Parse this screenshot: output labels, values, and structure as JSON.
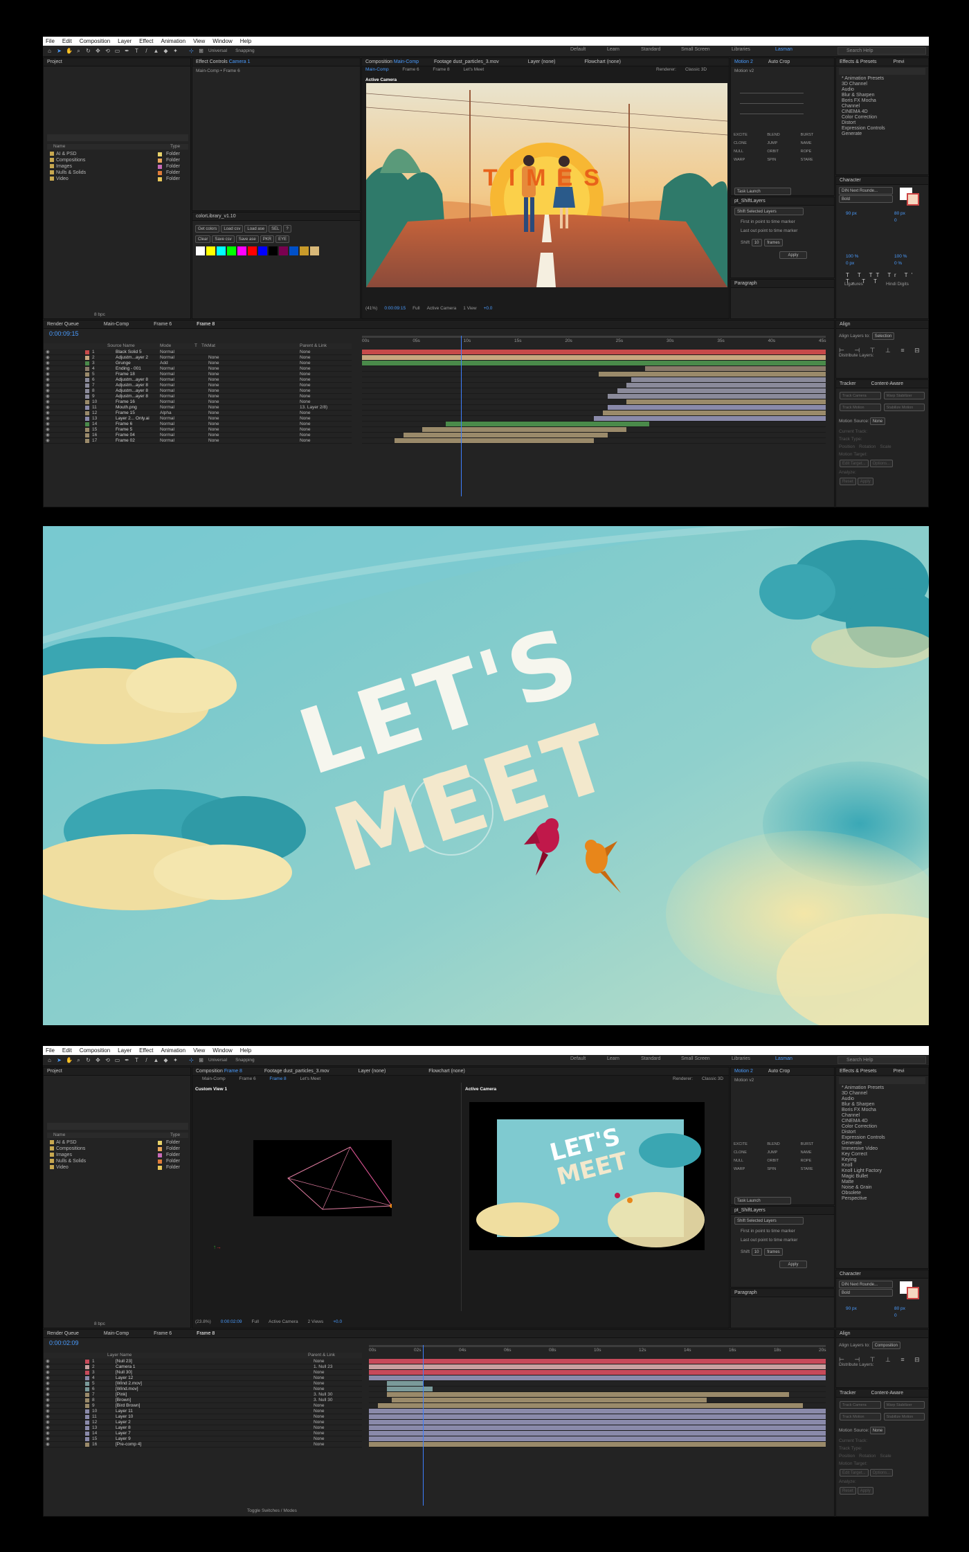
{
  "menu": [
    "File",
    "Edit",
    "Composition",
    "Layer",
    "Effect",
    "Animation",
    "View",
    "Window",
    "Help"
  ],
  "toolbar": {
    "universal": "Universal",
    "snapping": "Snapping"
  },
  "workspaces": [
    "Default",
    "Learn",
    "Standard",
    "Small Screen",
    "Libraries",
    "Lasman"
  ],
  "search_placeholder": "Search Help",
  "project": {
    "title": "Project",
    "col_name": "Name",
    "col_type": "Type",
    "folders": [
      {
        "name": "AI & PSD",
        "type": "Folder",
        "color": "#e8d36a"
      },
      {
        "name": "Compositions",
        "type": "Folder",
        "color": "#e8a55a"
      },
      {
        "name": "Images",
        "type": "Folder",
        "color": "#c86ab8"
      },
      {
        "name": "Nulls & Solids",
        "type": "Folder",
        "color": "#e07c3a"
      },
      {
        "name": "Video",
        "type": "Folder",
        "color": "#e8c75a"
      }
    ],
    "bpc": "8 bpc"
  },
  "effect_controls": {
    "title": "Effect Controls",
    "target": "Camera 1",
    "subtitle": "Main-Comp • Frame 6"
  },
  "colorlib": {
    "title": "colorLibrary_v1.10",
    "buttons1": [
      "Get colors",
      "Load csv",
      "Load ase",
      "SEL",
      "?"
    ],
    "buttons2": [
      "Clear",
      "Save csv",
      "Save ase",
      "PKR",
      "EYE"
    ],
    "swatches": [
      "#ffffff",
      "#ffff00",
      "#00ffff",
      "#00ff00",
      "#ff00ff",
      "#ff0000",
      "#0000ff",
      "#000000",
      "#7a0050",
      "#0050c8",
      "#c89a2a",
      "#d8b878"
    ]
  },
  "comp1": {
    "title": "Composition",
    "name": "Main-Comp",
    "footage": "Footage dust_particles_3.mov",
    "layer": "Layer (none)",
    "flowchart": "Flowchart (none)",
    "tabs": [
      "Main-Comp",
      "Frame 6",
      "Frame 8",
      "Let's Meet"
    ],
    "renderer": "Renderer:",
    "renderer_val": "Classic 3D",
    "view_label": "Active Camera",
    "zoom": "(41%)",
    "time": "0:00:09:15",
    "res": "Full",
    "camera": "Active Camera",
    "views": "1 View",
    "exposure": "+0.0"
  },
  "scene_text": "TIMES",
  "motion": {
    "title": "Motion 2",
    "autocrop": "Auto Crop",
    "preset": "Motion v2",
    "task": "Task Launch",
    "buttons": [
      "EXCITE",
      "BLEND",
      "BURST",
      "CLONE",
      "JUMP",
      "NAME",
      "NULL",
      "ORBIT",
      "ROPE",
      "WARP",
      "SPIN",
      "STARE"
    ]
  },
  "shift": {
    "title": "pt_ShiftLayers",
    "mode": "Shift Selected Layers",
    "opt1": "First in point to time marker",
    "opt2": "Last out point to time marker",
    "shift": "Shift",
    "amount": "10",
    "unit": "frames",
    "apply": "Apply"
  },
  "paragraph": {
    "title": "Paragraph"
  },
  "fxpresets": {
    "title": "Effects & Presets",
    "tab2": "Previ",
    "items": [
      "* Animation Presets",
      "3D Channel",
      "Audio",
      "Blur & Sharpen",
      "Boris FX Mocha",
      "Channel",
      "CINEMA 4D",
      "Color Correction",
      "Distort",
      "Expression Controls",
      "Generate"
    ]
  },
  "fxpresets2": [
    "* Animation Presets",
    "3D Channel",
    "Audio",
    "Blur & Sharpen",
    "Boris FX Mocha",
    "Channel",
    "CINEMA 4D",
    "Color Correction",
    "Distort",
    "Expression Controls",
    "Generate",
    "Immersive Video",
    "Key Correct",
    "Keying",
    "Knoll",
    "Knoll Light Factory",
    "Magic Bullet",
    "Matte",
    "Noise & Grain",
    "Obsolete",
    "Perspective"
  ],
  "character": {
    "title": "Character",
    "font": "DIN Next Rounde...",
    "style": "Bold",
    "size": "90 px",
    "lead": "80 px",
    "tracking": "0",
    "kern": "0",
    "scale_v": "100 %",
    "scale_h": "100 %",
    "baseline": "0 px",
    "tsume": "0 %",
    "ligatures": "Ligatures",
    "hindi": "Hindi Digits"
  },
  "align": {
    "title": "Align",
    "label": "Align Layers to:",
    "val": "Selection",
    "val2": "Composition",
    "distribute": "Distribute Layers:"
  },
  "tracker": {
    "title": "Tracker",
    "tab2": "Content-Aware",
    "motion_source": "Motion Source:",
    "none": "None",
    "current": "Current Track:",
    "track_type": "Track Type:",
    "stabilize": "Stabilize",
    "position": "Position",
    "rotation": "Rotation",
    "scale": "Scale",
    "motion_target": "Motion Target:",
    "edit_target": "Edit Target...",
    "options": "Options...",
    "analyze": "Analyze:",
    "reset": "Reset",
    "apply": "Apply",
    "track_camera": "Track Camera",
    "warp": "Warp Stabilizer",
    "track_motion": "Track Motion",
    "stabilize_motion": "Stabilize Motion"
  },
  "timeline1": {
    "tabs": [
      "Render Queue",
      "Main-Comp",
      "Frame 6",
      "Frame 8"
    ],
    "time": "0:00:09:15",
    "cols": {
      "source": "Source Name",
      "mode": "Mode",
      "t": "T",
      "trkmat": "TrkMat",
      "parent": "Parent & Link"
    },
    "ticks": [
      "00s",
      "05s",
      "10s",
      "15s",
      "20s",
      "25s",
      "30s",
      "35s",
      "40s",
      "45s"
    ],
    "layers": [
      {
        "n": "1",
        "name": "Black Solid 5",
        "mode": "Normal",
        "trk": "",
        "par": "None",
        "color": "#c74a4a"
      },
      {
        "n": "2",
        "name": "Adjustm...ayer 2",
        "mode": "Normal",
        "trk": "None",
        "par": "None",
        "color": "#c8a880"
      },
      {
        "n": "3",
        "name": "Grunge",
        "mode": "Add",
        "trk": "None",
        "par": "None",
        "color": "#4a8a4a"
      },
      {
        "n": "4",
        "name": "Ending - 001",
        "mode": "Normal",
        "trk": "None",
        "par": "None",
        "color": "#8a7a6a"
      },
      {
        "n": "5",
        "name": "Frame 18",
        "mode": "Normal",
        "trk": "None",
        "par": "None",
        "color": "#9a8a6a"
      },
      {
        "n": "6",
        "name": "Adjustm...ayer 8",
        "mode": "Normal",
        "trk": "None",
        "par": "None",
        "color": "#8a8a9a"
      },
      {
        "n": "7",
        "name": "Adjustm...ayer 8",
        "mode": "Normal",
        "trk": "None",
        "par": "None",
        "color": "#8a8a9a"
      },
      {
        "n": "8",
        "name": "Adjustm...ayer 8",
        "mode": "Normal",
        "trk": "None",
        "par": "None",
        "color": "#8a8a9a"
      },
      {
        "n": "9",
        "name": "Adjustm...ayer 8",
        "mode": "Normal",
        "trk": "None",
        "par": "None",
        "color": "#8a8a9a"
      },
      {
        "n": "10",
        "name": "Frame 16",
        "mode": "Normal",
        "trk": "None",
        "par": "None",
        "color": "#9a8a6a"
      },
      {
        "n": "11",
        "name": "Mouth.png",
        "mode": "Normal",
        "trk": "None",
        "par": "13. Layer 2/8)",
        "color": "#8a8aaa"
      },
      {
        "n": "12",
        "name": "Frame 15",
        "mode": "Alpha",
        "trk": "None",
        "par": "None",
        "color": "#9a8a6a"
      },
      {
        "n": "13",
        "name": "Layer 2... Only.ai",
        "mode": "Normal",
        "trk": "None",
        "par": "None",
        "color": "#8a8aaa"
      },
      {
        "n": "14",
        "name": "Frame 6",
        "mode": "Normal",
        "trk": "None",
        "par": "None",
        "color": "#4a8a4a"
      },
      {
        "n": "15",
        "name": "Frame 5",
        "mode": "Normal",
        "trk": "None",
        "par": "None",
        "color": "#9a8a6a"
      },
      {
        "n": "16",
        "name": "Frame 04",
        "mode": "Normal",
        "trk": "None",
        "par": "None",
        "color": "#9a8a6a"
      },
      {
        "n": "17",
        "name": "Frame 02",
        "mode": "Normal",
        "trk": "None",
        "par": "None",
        "color": "#9a8a6a"
      }
    ]
  },
  "art_title": {
    "line1": "LET'S",
    "line2": "MEET"
  },
  "comp2": {
    "title": "Composition",
    "name": "Frame 8",
    "footage": "Footage dust_particles_3.mov",
    "layer": "Layer (none)",
    "flowchart": "Flowchart (none)",
    "tabs": [
      "Main-Comp",
      "Frame 6",
      "Frame 8",
      "Let's Meet"
    ],
    "renderer": "Renderer:",
    "renderer_val": "Classic 3D",
    "view_left": "Custom View 1",
    "view_right": "Active Camera",
    "zoom": "(23.8%)",
    "time": "0:00:02:09",
    "res": "Full",
    "camera": "Active Camera",
    "views": "2 Views",
    "exposure": "+0.0"
  },
  "timeline2": {
    "tabs": [
      "Render Queue",
      "Main-Comp",
      "Frame 6",
      "Frame 8"
    ],
    "time": "0:00:02:09",
    "col_layer": "Layer Name",
    "col_parent": "Parent & Link",
    "ticks": [
      "00s",
      "02s",
      "04s",
      "06s",
      "08s",
      "10s",
      "12s",
      "14s",
      "16s",
      "18s",
      "20s"
    ],
    "toggle": "Toggle Switches / Modes",
    "layers": [
      {
        "n": "1",
        "name": "[Null 23]",
        "par": "None",
        "color": "#c74a5a"
      },
      {
        "n": "2",
        "name": "Camera 1",
        "par": "1. Null 23",
        "color": "#c8a0a0"
      },
      {
        "n": "3",
        "name": "[Null 30]",
        "par": "None",
        "color": "#c74a5a"
      },
      {
        "n": "4",
        "name": "Layer 12",
        "par": "None",
        "color": "#8a8aaa"
      },
      {
        "n": "5",
        "name": "[Wind 2.mov]",
        "par": "None",
        "color": "#7a9a9a"
      },
      {
        "n": "6",
        "name": "[Wind.mov]",
        "par": "None",
        "color": "#7a9a9a"
      },
      {
        "n": "7",
        "name": "[Pink]",
        "par": "3. Null 30",
        "color": "#9a8a6a"
      },
      {
        "n": "8",
        "name": "[Brown]",
        "par": "3. Null 30",
        "color": "#9a8a6a"
      },
      {
        "n": "9",
        "name": "[Bird Brown]",
        "par": "None",
        "color": "#9a8a6a"
      },
      {
        "n": "10",
        "name": "Layer 11",
        "par": "None",
        "color": "#8a8aaa"
      },
      {
        "n": "11",
        "name": "Layer 10",
        "par": "None",
        "color": "#8a8aaa"
      },
      {
        "n": "12",
        "name": "Layer 2",
        "par": "None",
        "color": "#8a8aaa"
      },
      {
        "n": "13",
        "name": "Layer 8",
        "par": "None",
        "color": "#8a8aaa"
      },
      {
        "n": "14",
        "name": "Layer 7",
        "par": "None",
        "color": "#8a8aaa"
      },
      {
        "n": "15",
        "name": "Layer 9",
        "par": "None",
        "color": "#8a8aaa"
      },
      {
        "n": "16",
        "name": "[Pre-comp 4]",
        "par": "None",
        "color": "#9a8a6a"
      }
    ]
  }
}
